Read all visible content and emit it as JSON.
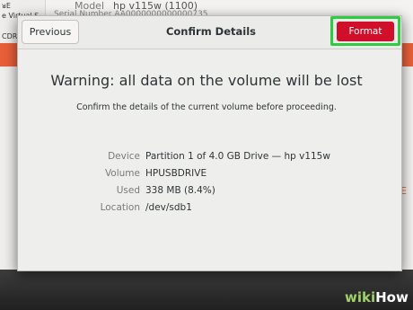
{
  "background": {
    "sidebar_lines": [
      "ᴚE",
      "e Virtual S",
      "CDR"
    ],
    "model_label": "Model",
    "model_value": "hp v115w (1100)",
    "serial_partial": "Serial Number   AA0000000000000735",
    "edge_letter": "E"
  },
  "dialog": {
    "title": "Confirm Details",
    "previous_label": "Previous",
    "format_label": "Format",
    "warning": "Warning: all data on the volume will be lost",
    "subtitle": "Confirm the details of the current volume before proceeding.",
    "details": [
      {
        "key": "Device",
        "value": "Partition 1 of 4.0 GB Drive — hp v115w"
      },
      {
        "key": "Volume",
        "value": "HPUSBDRIVE"
      },
      {
        "key": "Used",
        "value": "338 MB (8.4%)"
      },
      {
        "key": "Location",
        "value": "/dev/sdb1"
      }
    ]
  },
  "watermark": {
    "part1": "wiki",
    "part2": "How"
  },
  "colors": {
    "format_button": "#d0102a",
    "highlight_outline": "#2ecc40",
    "accent_orange": "#e9603a"
  }
}
